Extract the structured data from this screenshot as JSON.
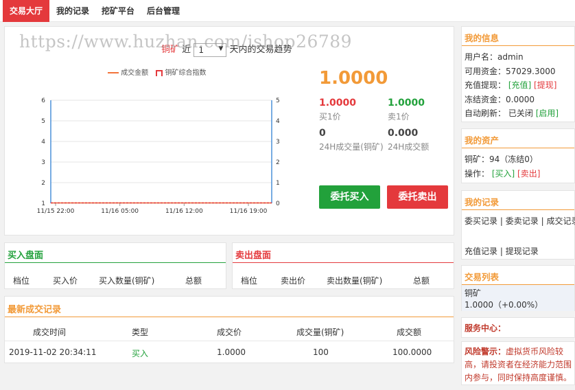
{
  "nav": {
    "items": [
      {
        "label": "交易大厅",
        "active": true
      },
      {
        "label": "我的记录",
        "active": false
      },
      {
        "label": "挖矿平台",
        "active": false
      },
      {
        "label": "后台管理",
        "active": false
      }
    ]
  },
  "watermark": "https://www.huzhan.com/ishop26789",
  "chart_header": {
    "coin": "铜矿",
    "prefix": "近",
    "days_value": "1",
    "suffix": "天内的交易趋势"
  },
  "chart_data": {
    "type": "line",
    "legend": [
      "成交金额",
      "铜矿综合指数"
    ],
    "x_ticks": [
      "11/15 22:00",
      "11/16 05:00",
      "11/16 12:00",
      "11/16 19:00"
    ],
    "y_left_ticks": [
      "1",
      "2",
      "3",
      "4",
      "5",
      "6"
    ],
    "y_right_ticks": [
      "0",
      "1",
      "2",
      "3",
      "4",
      "5"
    ],
    "y_left_range": [
      1,
      6
    ],
    "y_right_range": [
      0,
      5
    ],
    "series": [
      {
        "name": "成交金额",
        "color": "#f2733a",
        "axis": "left",
        "values": [
          1,
          1,
          1,
          1,
          1
        ]
      },
      {
        "name": "铜矿综合指数",
        "color": "#e4393c",
        "axis": "right",
        "values": [
          0,
          0,
          0,
          0,
          0
        ]
      }
    ],
    "grid": true,
    "legend_position": "top"
  },
  "ticker": {
    "price": "1.0000",
    "buy1_value": "1.0000",
    "buy1_label": "买1价",
    "sell1_value": "1.0000",
    "sell1_label": "卖1价",
    "vol_value": "0",
    "vol_label": "24H成交量(铜矿)",
    "amt_value": "0.000",
    "amt_label": "24H成交额"
  },
  "buttons": {
    "buy": "委托买入",
    "sell": "委托卖出"
  },
  "buy_book": {
    "title": "买入盘面",
    "headers": [
      "档位",
      "买入价",
      "买入数量(铜矿)",
      "总额"
    ]
  },
  "sell_book": {
    "title": "卖出盘面",
    "headers": [
      "档位",
      "卖出价",
      "卖出数量(铜矿)",
      "总额"
    ]
  },
  "trades": {
    "title": "最新成交记录",
    "headers": [
      "成交时间",
      "类型",
      "成交价",
      "成交量(铜矿)",
      "成交额"
    ],
    "rows": [
      {
        "time": "2019-11-02 20:34:11",
        "type": "买入",
        "price": "1.0000",
        "qty": "100",
        "amount": "100.0000"
      }
    ]
  },
  "myinfo": {
    "title": "我的信息",
    "username": "用户名：admin",
    "balance": "可用资金：57029.3000",
    "recharge_label": "充值提现：",
    "recharge_link": "[充值]",
    "withdraw_link": "[提现]",
    "frozen": "冻结资金：0.0000",
    "refresh_label": "自动刷新：",
    "refresh_state": "已关闭",
    "refresh_link": "[启用]"
  },
  "assets": {
    "title": "我的资产",
    "line": "铜矿：94（冻结0）",
    "op_label": "操作：",
    "buy_link": "[买入]",
    "sell_link": "[卖出]"
  },
  "records": {
    "title": "我的记录",
    "links": [
      "委买记录",
      "委卖记录",
      "成交记录",
      "充值记录",
      "提现记录"
    ],
    "sep": "|"
  },
  "tradelist": {
    "title": "交易列表",
    "coin": "铜矿",
    "quote": "1.0000（+0.00%）"
  },
  "service": {
    "title": "服务中心："
  },
  "risk": {
    "label": "风险警示：",
    "line1": "虚拟货币风险较",
    "line2": "高，请投资者在经济能力范围",
    "line3": "内参与，同时保持高度谨慎。"
  },
  "colors": {
    "accent_red": "#e4393c",
    "accent_orange": "#f29a38",
    "accent_green": "#22a13b",
    "chart_axis_blue": "#4a90d9"
  }
}
